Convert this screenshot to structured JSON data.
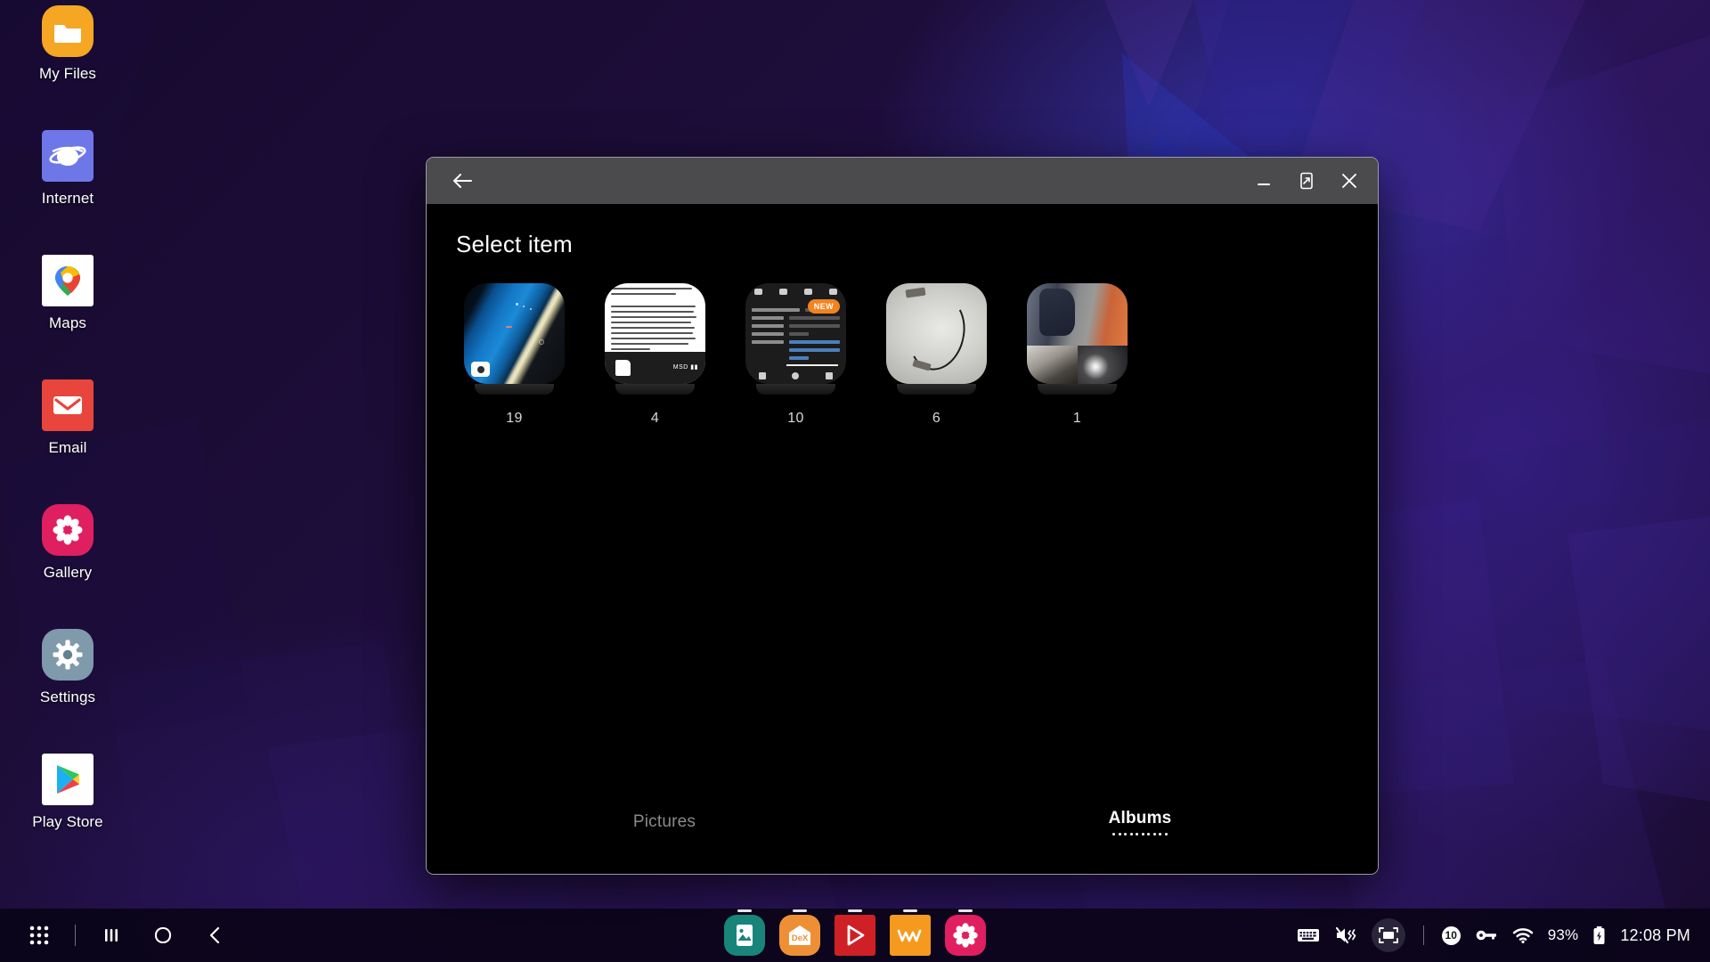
{
  "desktop": {
    "icons": [
      {
        "label": "My Files",
        "icon": "folder-icon"
      },
      {
        "label": "Internet",
        "icon": "internet-globe-icon"
      },
      {
        "label": "Maps",
        "icon": "maps-pin-icon"
      },
      {
        "label": "Email",
        "icon": "envelope-icon"
      },
      {
        "label": "Gallery",
        "icon": "flower-icon"
      },
      {
        "label": "Settings",
        "icon": "gear-icon"
      },
      {
        "label": "Play Store",
        "icon": "play-triangle-icon"
      }
    ]
  },
  "window": {
    "title_bar": {
      "back_icon": "arrow-left-icon",
      "minimize_icon": "minimize-icon",
      "maximize_icon": "maximize-expand-icon",
      "close_icon": "close-x-icon"
    },
    "heading": "Select item",
    "albums": [
      {
        "count": "19",
        "badge": "",
        "thumb": "blue-phone-wallpaper",
        "has_camera_badge": true
      },
      {
        "count": "4",
        "badge": "",
        "thumb": "article-screenshot",
        "has_camera_badge": false
      },
      {
        "count": "10",
        "badge": "NEW",
        "thumb": "video-details-screenshot",
        "has_camera_badge": false
      },
      {
        "count": "6",
        "badge": "",
        "thumb": "cable-in-bag-photo",
        "has_camera_badge": false
      },
      {
        "count": "1",
        "badge": "",
        "thumb": "collage-photos",
        "has_camera_badge": false
      }
    ],
    "tabs": [
      {
        "label": "Pictures",
        "active": false
      },
      {
        "label": "Albums",
        "active": true
      }
    ]
  },
  "taskbar": {
    "nav": [
      {
        "name": "apps-grid-button",
        "icon": "apps-grid-icon"
      },
      {
        "name": "recents-button",
        "icon": "recents-bars-icon"
      },
      {
        "name": "home-button",
        "icon": "home-circle-icon"
      },
      {
        "name": "back-button",
        "icon": "chevron-left-icon"
      }
    ],
    "apps": [
      {
        "name": "wallpaper-app",
        "icon": "photo-icon",
        "color": "#19847a"
      },
      {
        "name": "dex-app",
        "icon": "dex-icon",
        "color": "#ef8f35"
      },
      {
        "name": "video-player-app",
        "icon": "play-icon",
        "color": "#cf2125"
      },
      {
        "name": "wm-app",
        "icon": "wm-icon",
        "color": "#f59a1e"
      },
      {
        "name": "gallery-app",
        "icon": "flower-icon",
        "color": "#e01f60"
      }
    ],
    "tray": {
      "keyboard_icon": "keyboard-icon",
      "mute_icon": "volume-mute-vibrate-icon",
      "screenshot_icon": "screenshot-capture-icon",
      "notification_count": "10",
      "vpn_icon": "vpn-key-icon",
      "wifi_icon": "wifi-icon",
      "battery_percent": "93%",
      "battery_icon": "battery-charging-icon",
      "clock": "12:08 PM"
    }
  }
}
